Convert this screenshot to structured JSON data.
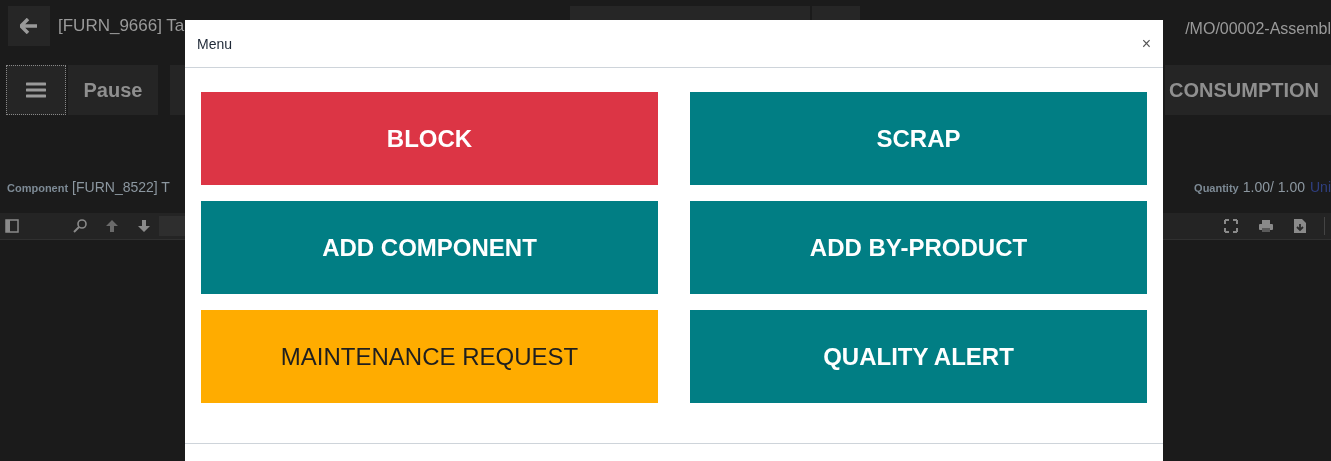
{
  "header": {
    "title": "[FURN_9666] Ta",
    "reference": "/MO/00002-Assembl"
  },
  "actions": {
    "pause": "Pause",
    "consumption": "CONSUMPTION"
  },
  "component": {
    "label": "Component",
    "value": "[FURN_8522] T"
  },
  "quantity": {
    "label": "Quantity",
    "value": "1.00/ 1.00",
    "unit": "Uni"
  },
  "dialog": {
    "title": "Menu",
    "close": "×",
    "buttons": [
      {
        "label": "BLOCK",
        "kind": "danger"
      },
      {
        "label": "SCRAP",
        "kind": "primary"
      },
      {
        "label": "ADD COMPONENT",
        "kind": "primary"
      },
      {
        "label": "ADD BY-PRODUCT",
        "kind": "primary"
      },
      {
        "label": "MAINTENANCE REQUEST",
        "kind": "warning"
      },
      {
        "label": "QUALITY ALERT",
        "kind": "primary"
      }
    ]
  }
}
